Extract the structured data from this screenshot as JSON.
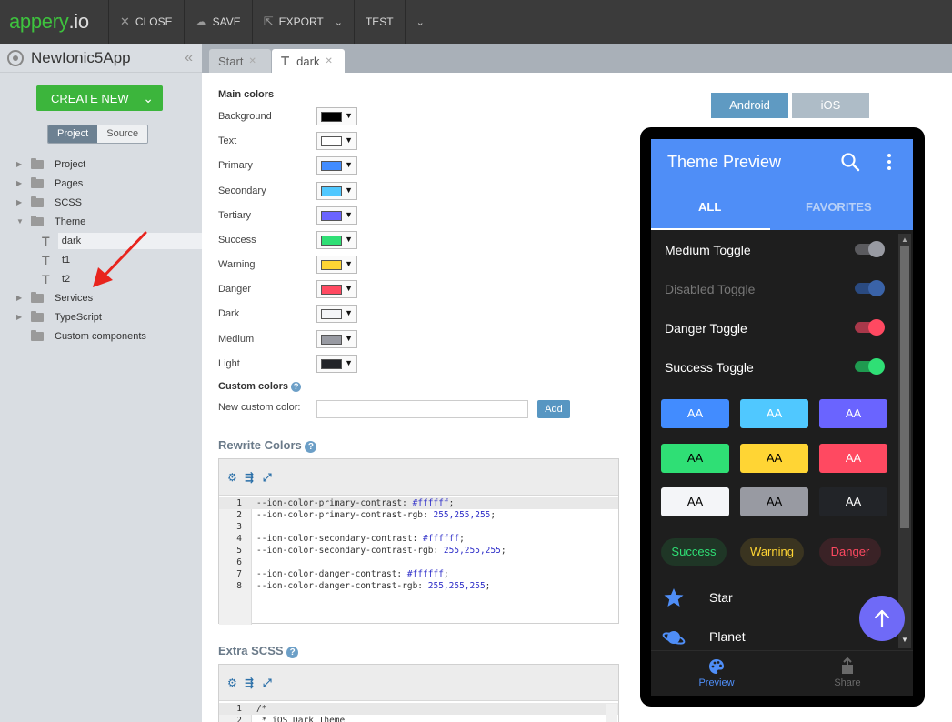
{
  "topbar": {
    "logo_main": "appery",
    "logo_tld": ".io",
    "close_label": "CLOSE",
    "save_label": "SAVE",
    "export_label": "EXPORT",
    "test_label": "TEST"
  },
  "sidebar": {
    "app_name": "NewIonic5App",
    "create_new_label": "CREATE NEW",
    "tab_project": "Project",
    "tab_source": "Source",
    "tree": {
      "project": "Project",
      "pages": "Pages",
      "scss": "SCSS",
      "theme": "Theme",
      "theme_files": [
        "dark",
        "t1",
        "t2"
      ],
      "services": "Services",
      "typescript": "TypeScript",
      "custom_components": "Custom components"
    }
  },
  "tabs": {
    "start": "Start",
    "dark": "dark"
  },
  "form": {
    "main_colors_title": "Main colors",
    "colors": [
      {
        "label": "Background",
        "color": "#000000"
      },
      {
        "label": "Text",
        "color": "#ffffff"
      },
      {
        "label": "Primary",
        "color": "#428cff"
      },
      {
        "label": "Secondary",
        "color": "#50c8ff"
      },
      {
        "label": "Tertiary",
        "color": "#6a64ff"
      },
      {
        "label": "Success",
        "color": "#2fdf75"
      },
      {
        "label": "Warning",
        "color": "#ffd534"
      },
      {
        "label": "Danger",
        "color": "#ff4961"
      },
      {
        "label": "Dark",
        "color": "#f4f5f8"
      },
      {
        "label": "Medium",
        "color": "#989aa2"
      },
      {
        "label": "Light",
        "color": "#222428"
      }
    ],
    "custom_colors_title": "Custom colors",
    "new_custom_color_label": "New custom color:",
    "new_custom_color_value": "",
    "add_label": "Add",
    "rewrite_colors_title": "Rewrite Colors",
    "extra_scss_title": "Extra SCSS",
    "rewrite_code": [
      {
        "n": "1",
        "prop": "--ion-color-primary-contrast: ",
        "val": "#ffffff",
        "end": ";"
      },
      {
        "n": "2",
        "prop": "--ion-color-primary-contrast-rgb: ",
        "val": "255,255,255",
        "end": ";"
      },
      {
        "n": "3",
        "prop": "",
        "val": "",
        "end": ""
      },
      {
        "n": "4",
        "prop": "--ion-color-secondary-contrast: ",
        "val": "#ffffff",
        "end": ";"
      },
      {
        "n": "5",
        "prop": "--ion-color-secondary-contrast-rgb: ",
        "val": "255,255,255",
        "end": ";"
      },
      {
        "n": "6",
        "prop": "",
        "val": "",
        "end": ""
      },
      {
        "n": "7",
        "prop": "--ion-color-danger-contrast: ",
        "val": "#ffffff",
        "end": ";"
      },
      {
        "n": "8",
        "prop": "--ion-color-danger-contrast-rgb: ",
        "val": "255,255,255",
        "end": ";"
      }
    ],
    "extra_code": [
      {
        "n": "1",
        "text": "/*"
      },
      {
        "n": "2",
        "text": " * iOS Dark Theme"
      }
    ]
  },
  "preview": {
    "platform_android": "Android",
    "platform_ios": "iOS",
    "title": "Theme Preview",
    "tab_all": "ALL",
    "tab_favorites": "FAVORITES",
    "toggles": [
      {
        "label": "Medium Toggle",
        "track": "#5a5a5e",
        "knob": "#989aa2",
        "disabled": false
      },
      {
        "label": "Disabled Toggle",
        "track": "#2a4a80",
        "knob": "#3a63a8",
        "disabled": true
      },
      {
        "label": "Danger Toggle",
        "track": "#a8384a",
        "knob": "#ff4961",
        "disabled": false
      },
      {
        "label": "Success Toggle",
        "track": "#1f9a50",
        "knob": "#2fdf75",
        "disabled": false
      }
    ],
    "buttons_label": "AA",
    "button_colors": [
      {
        "bg": "#428cff",
        "fg": "#ffffff"
      },
      {
        "bg": "#50c8ff",
        "fg": "#ffffff"
      },
      {
        "bg": "#6a64ff",
        "fg": "#ffffff"
      },
      {
        "bg": "#2fdf75",
        "fg": "#000000"
      },
      {
        "bg": "#ffd534",
        "fg": "#000000"
      },
      {
        "bg": "#ff4961",
        "fg": "#ffffff"
      },
      {
        "bg": "#f4f5f8",
        "fg": "#000000"
      },
      {
        "bg": "#989aa2",
        "fg": "#000000"
      },
      {
        "bg": "#222428",
        "fg": "#ffffff"
      }
    ],
    "chips": [
      {
        "label": "Success",
        "fg": "#2fdf75",
        "bg": "#1f3626"
      },
      {
        "label": "Warning",
        "fg": "#ffd534",
        "bg": "#3a3420"
      },
      {
        "label": "Danger",
        "fg": "#ff4961",
        "bg": "#3a2226"
      }
    ],
    "list_star": "Star",
    "list_planet": "Planet",
    "footer_preview": "Preview",
    "footer_share": "Share"
  }
}
